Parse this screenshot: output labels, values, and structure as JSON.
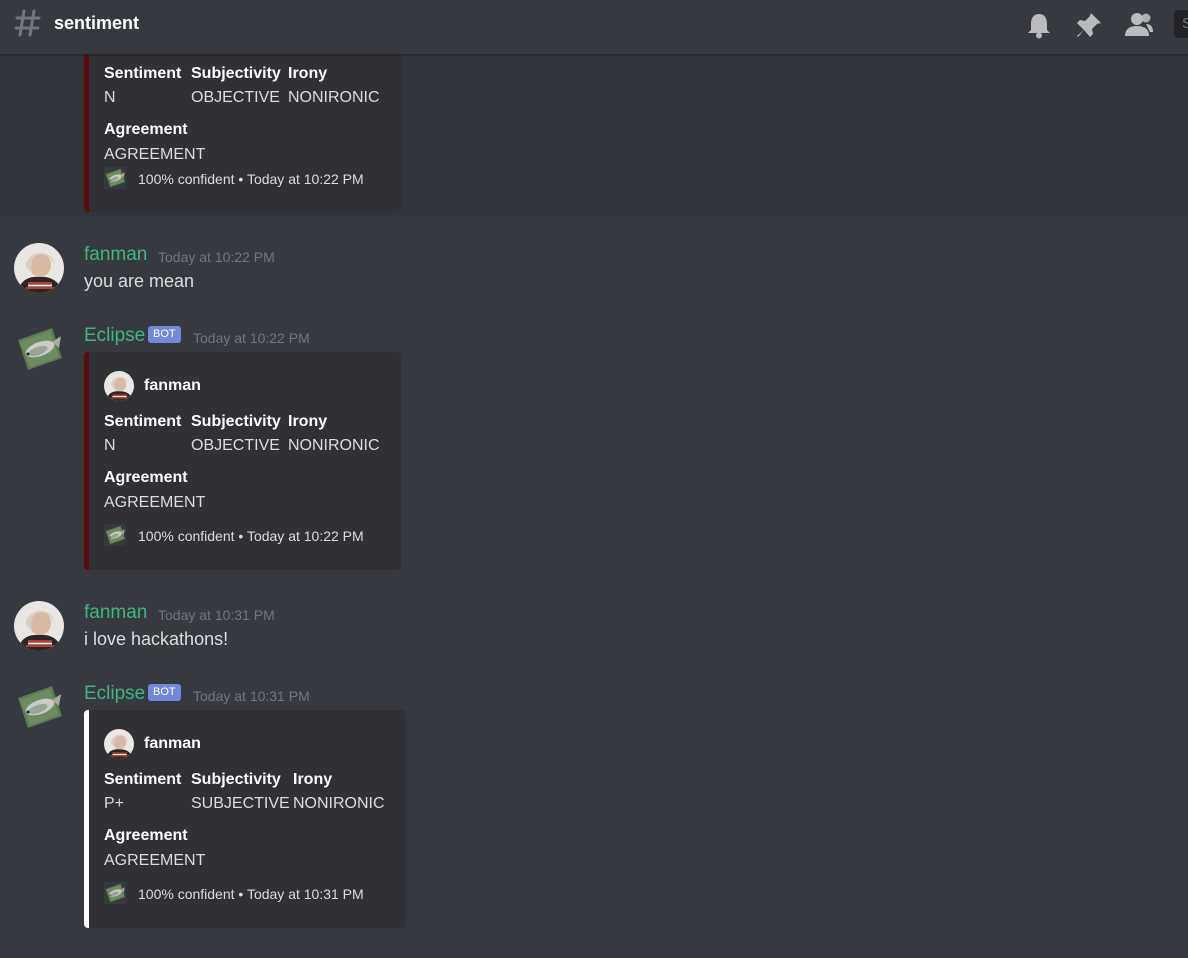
{
  "header": {
    "channel_name": "sentiment",
    "search_placeholder": "S"
  },
  "colors": {
    "background": "#36393f",
    "embed_background": "#2f3136",
    "username_green": "#43b581",
    "bot_tag": "#7289da",
    "embed_bar_dark_red": "#5a0b0b",
    "embed_bar_white": "#ffffff"
  },
  "messages": [
    {
      "embed": {
        "fields": [
          {
            "name": "Sentiment",
            "value": "N"
          },
          {
            "name": "Subjectivity",
            "value": "OBJECTIVE"
          },
          {
            "name": "Irony",
            "value": "NONIRONIC"
          },
          {
            "name": "Agreement",
            "value": "AGREEMENT"
          }
        ],
        "footer": "100% confident • Today at 10:22 PM"
      }
    },
    {
      "author": "fanman",
      "timestamp": "Today at 10:22 PM",
      "text": "you are mean"
    },
    {
      "author": "Eclipse",
      "bot_tag": "BOT",
      "timestamp": "Today at 10:22 PM",
      "embed": {
        "author": "fanman",
        "fields": [
          {
            "name": "Sentiment",
            "value": "N"
          },
          {
            "name": "Subjectivity",
            "value": "OBJECTIVE"
          },
          {
            "name": "Irony",
            "value": "NONIRONIC"
          },
          {
            "name": "Agreement",
            "value": "AGREEMENT"
          }
        ],
        "footer": "100% confident • Today at 10:22 PM"
      }
    },
    {
      "author": "fanman",
      "timestamp": "Today at 10:31 PM",
      "text": "i love hackathons!"
    },
    {
      "author": "Eclipse",
      "bot_tag": "BOT",
      "timestamp": "Today at 10:31 PM",
      "embed": {
        "author": "fanman",
        "fields": [
          {
            "name": "Sentiment",
            "value": "P+"
          },
          {
            "name": "Subjectivity",
            "value": "SUBJECTIVE"
          },
          {
            "name": "Irony",
            "value": "NONIRONIC"
          },
          {
            "name": "Agreement",
            "value": "AGREEMENT"
          }
        ],
        "footer": "100% confident • Today at 10:31 PM"
      }
    }
  ],
  "icons": {
    "channel": "hash-icon",
    "notifications": "bell-icon",
    "pins": "pin-icon",
    "members": "members-icon",
    "user_avatar": "fanman-avatar",
    "bot_avatar": "eclipse-fish-avatar"
  }
}
